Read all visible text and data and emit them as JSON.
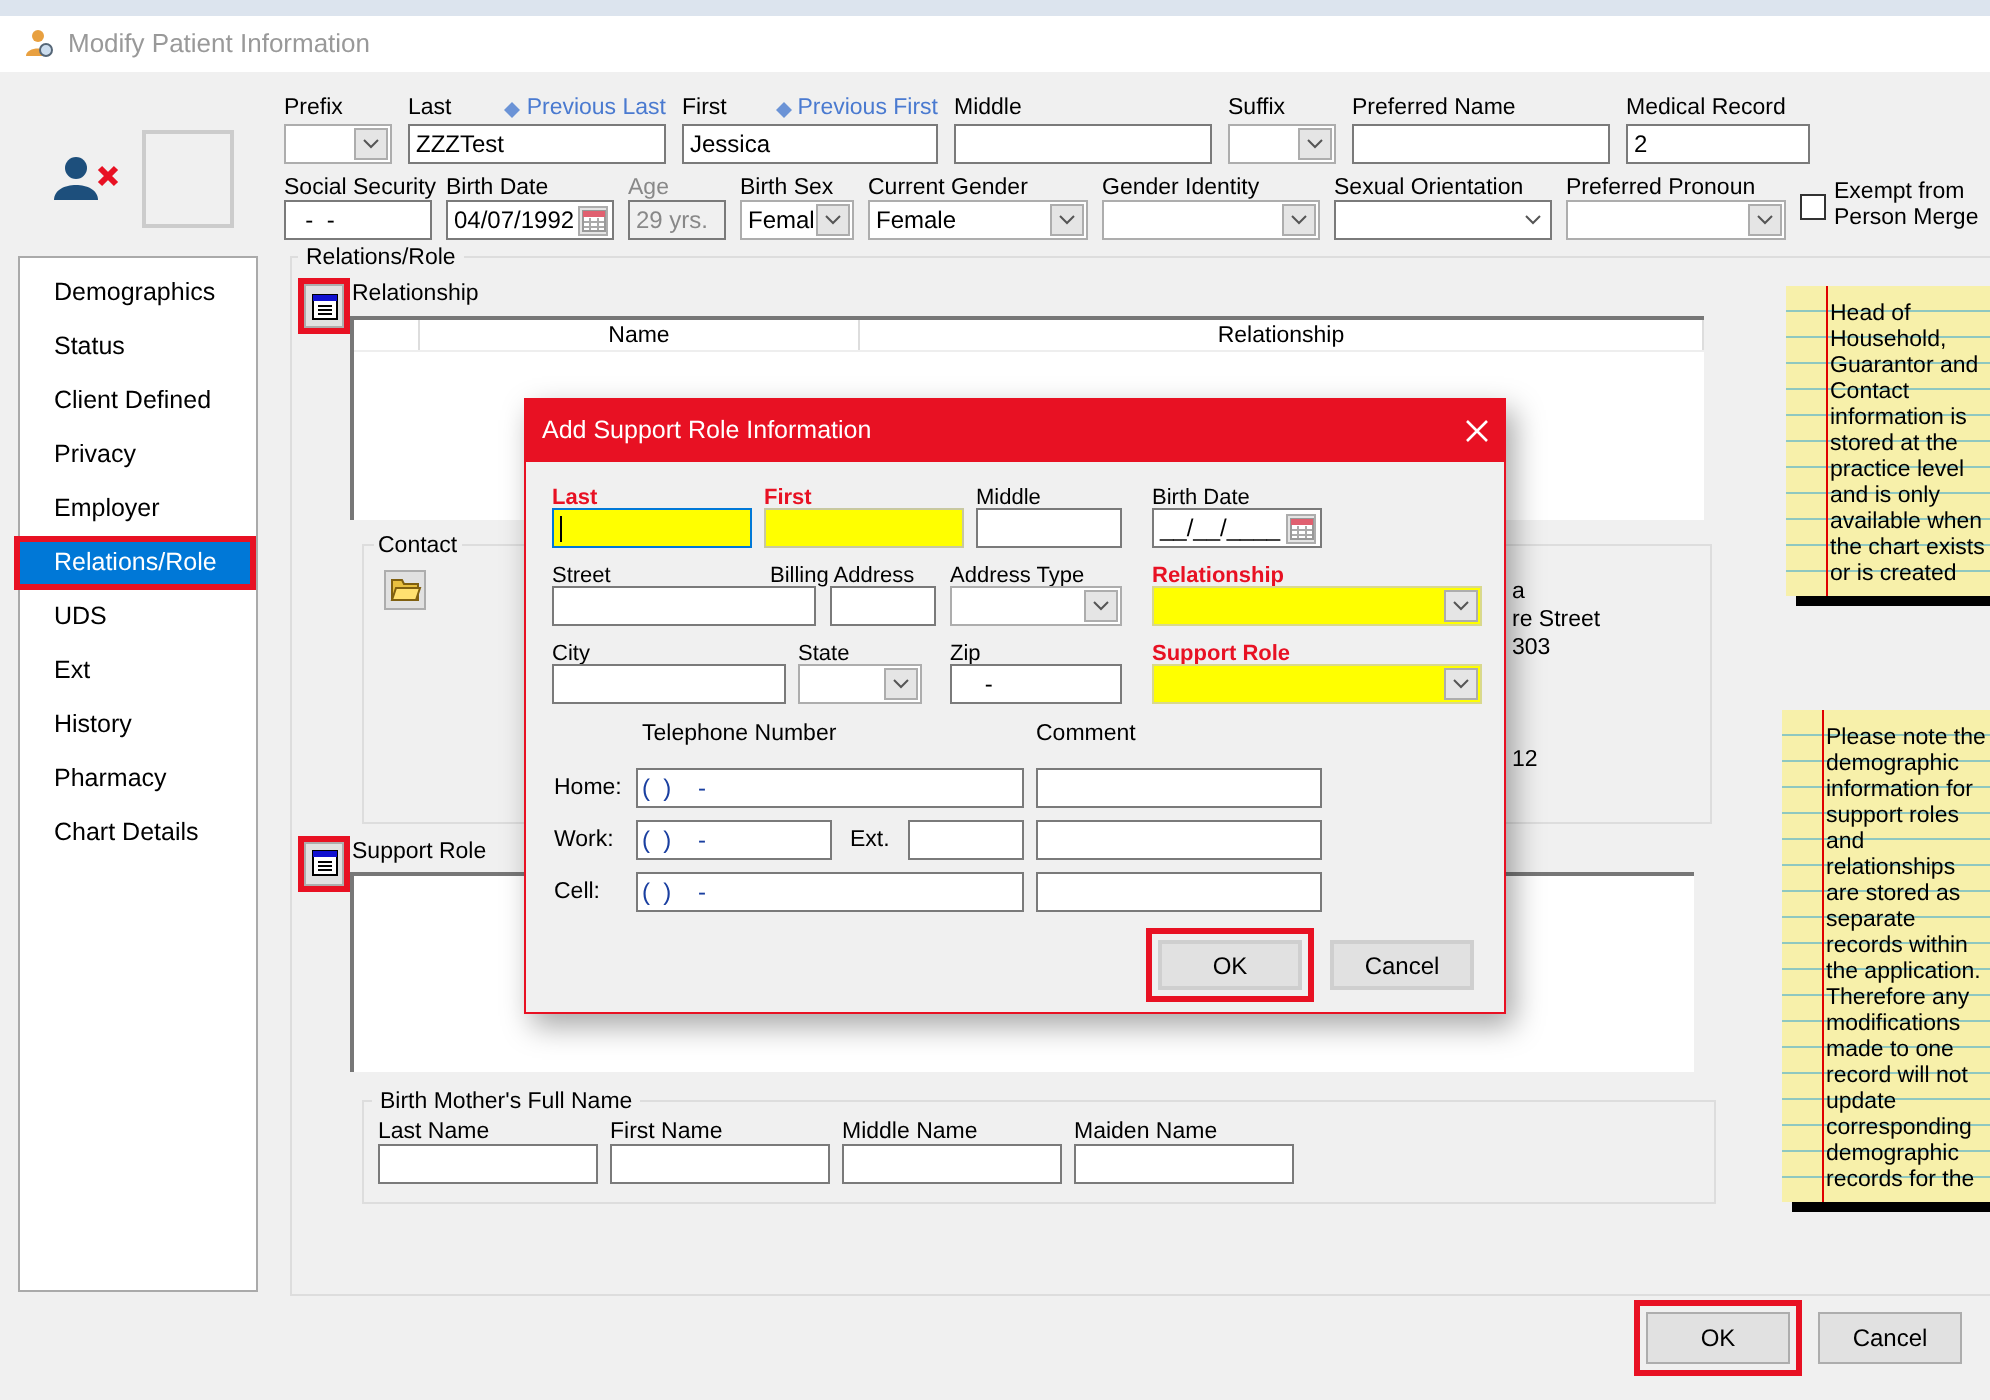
{
  "window": {
    "title": "Modify Patient Information"
  },
  "header": {
    "row1": [
      {
        "label": "Prefix",
        "kind": "dropdown"
      },
      {
        "label": "Last",
        "kind": "text",
        "value": "ZZZTest",
        "link": "Previous Last"
      },
      {
        "label": "First",
        "kind": "text",
        "value": "Jessica",
        "link": "Previous First"
      },
      {
        "label": "Middle",
        "kind": "text"
      },
      {
        "label": "Suffix",
        "kind": "dropdown"
      },
      {
        "label": "Preferred Name",
        "kind": "text"
      },
      {
        "label": "Medical Record",
        "kind": "text",
        "value": "2"
      }
    ],
    "row2": [
      {
        "label": "Social Security",
        "kind": "text",
        "value": "  -  -"
      },
      {
        "label": "Birth Date",
        "kind": "date",
        "value": "04/07/1992"
      },
      {
        "label": "Age",
        "kind": "readonly",
        "value": "29 yrs."
      },
      {
        "label": "Birth Sex",
        "kind": "dropdown",
        "value": "Femal"
      },
      {
        "label": "Current Gender",
        "kind": "dropdown",
        "value": "Female"
      },
      {
        "label": "Gender Identity",
        "kind": "dropdown"
      },
      {
        "label": "Sexual Orientation",
        "kind": "combo"
      },
      {
        "label": "Preferred Pronoun",
        "kind": "dropdown"
      }
    ],
    "exempt": {
      "label": "Exempt from Person Merge",
      "checked": false
    }
  },
  "nav": [
    {
      "label": "Demographics",
      "selected": false,
      "highlighted": false
    },
    {
      "label": "Status",
      "selected": false,
      "highlighted": false
    },
    {
      "label": "Client Defined",
      "selected": false,
      "highlighted": false
    },
    {
      "label": "Privacy",
      "selected": false,
      "highlighted": false
    },
    {
      "label": "Employer",
      "selected": false,
      "highlighted": false
    },
    {
      "label": "Relations/Role",
      "selected": true,
      "highlighted": true
    },
    {
      "label": "UDS",
      "selected": false,
      "highlighted": false
    },
    {
      "label": "Ext",
      "selected": false,
      "highlighted": false
    },
    {
      "label": "History",
      "selected": false,
      "highlighted": false
    },
    {
      "label": "Pharmacy",
      "selected": false,
      "highlighted": false
    },
    {
      "label": "Chart Details",
      "selected": false,
      "highlighted": false
    }
  ],
  "relations": {
    "title": "Relations/Role",
    "relationship": {
      "label": "Relationship",
      "highlighted": true,
      "columns": [
        "Name",
        "Relationship"
      ]
    },
    "contact": {
      "title": "Contact",
      "fragments": [
        "a",
        "re Street",
        "303",
        "12"
      ]
    },
    "support_role": {
      "label": "Support Role",
      "highlighted": true
    },
    "birth_mother": {
      "title": "Birth Mother's Full Name",
      "fields": [
        "Last Name",
        "First Name",
        "Middle Name",
        "Maiden Name"
      ]
    }
  },
  "notes": [
    "Head of Household, Guarantor and Contact information is stored at the practice level and is only available when the chart exists or is created",
    "Please note the demographic information for support roles and relationships are stored as separate records within the application.  Therefore any modifications made to one record will not update corresponding demographic records for the"
  ],
  "buttons": [
    {
      "label": "OK",
      "highlighted": true
    },
    {
      "label": "Cancel",
      "highlighted": false
    }
  ],
  "dialog": {
    "title": "Add Support Role Information",
    "rows": [
      [
        {
          "label": "Last",
          "kind": "text",
          "required": true,
          "focused": true
        },
        {
          "label": "First",
          "kind": "text",
          "required": true
        },
        {
          "label": "Middle",
          "kind": "text",
          "required": false
        },
        {
          "label": "Birth Date",
          "kind": "date",
          "required": false,
          "value": "__/__/____"
        }
      ],
      [
        {
          "label": "Street",
          "kind": "text",
          "required": false
        },
        {
          "label": "Billing Address",
          "kind": "text",
          "required": false
        },
        {
          "label": "Address Type",
          "kind": "dropdown",
          "required": false
        },
        {
          "label": "Relationship",
          "kind": "dropdown",
          "required": true
        }
      ],
      [
        {
          "label": "City",
          "kind": "text",
          "required": false
        },
        {
          "label": "State",
          "kind": "dropdown",
          "required": false
        },
        {
          "label": "Zip",
          "kind": "text",
          "required": false,
          "value": "    -"
        },
        {
          "label": "Support Role",
          "kind": "dropdown",
          "required": true
        }
      ]
    ],
    "phone_heading": "Telephone Number",
    "comment_heading": "Comment",
    "phones": [
      {
        "label": "Home:",
        "value": "(  )    -"
      },
      {
        "label": "Work:",
        "value": "(  )    -",
        "ext_label": "Ext."
      },
      {
        "label": "Cell:",
        "value": "(  )    -"
      }
    ],
    "buttons": [
      {
        "label": "OK",
        "highlighted": true
      },
      {
        "label": "Cancel",
        "highlighted": false
      }
    ]
  }
}
